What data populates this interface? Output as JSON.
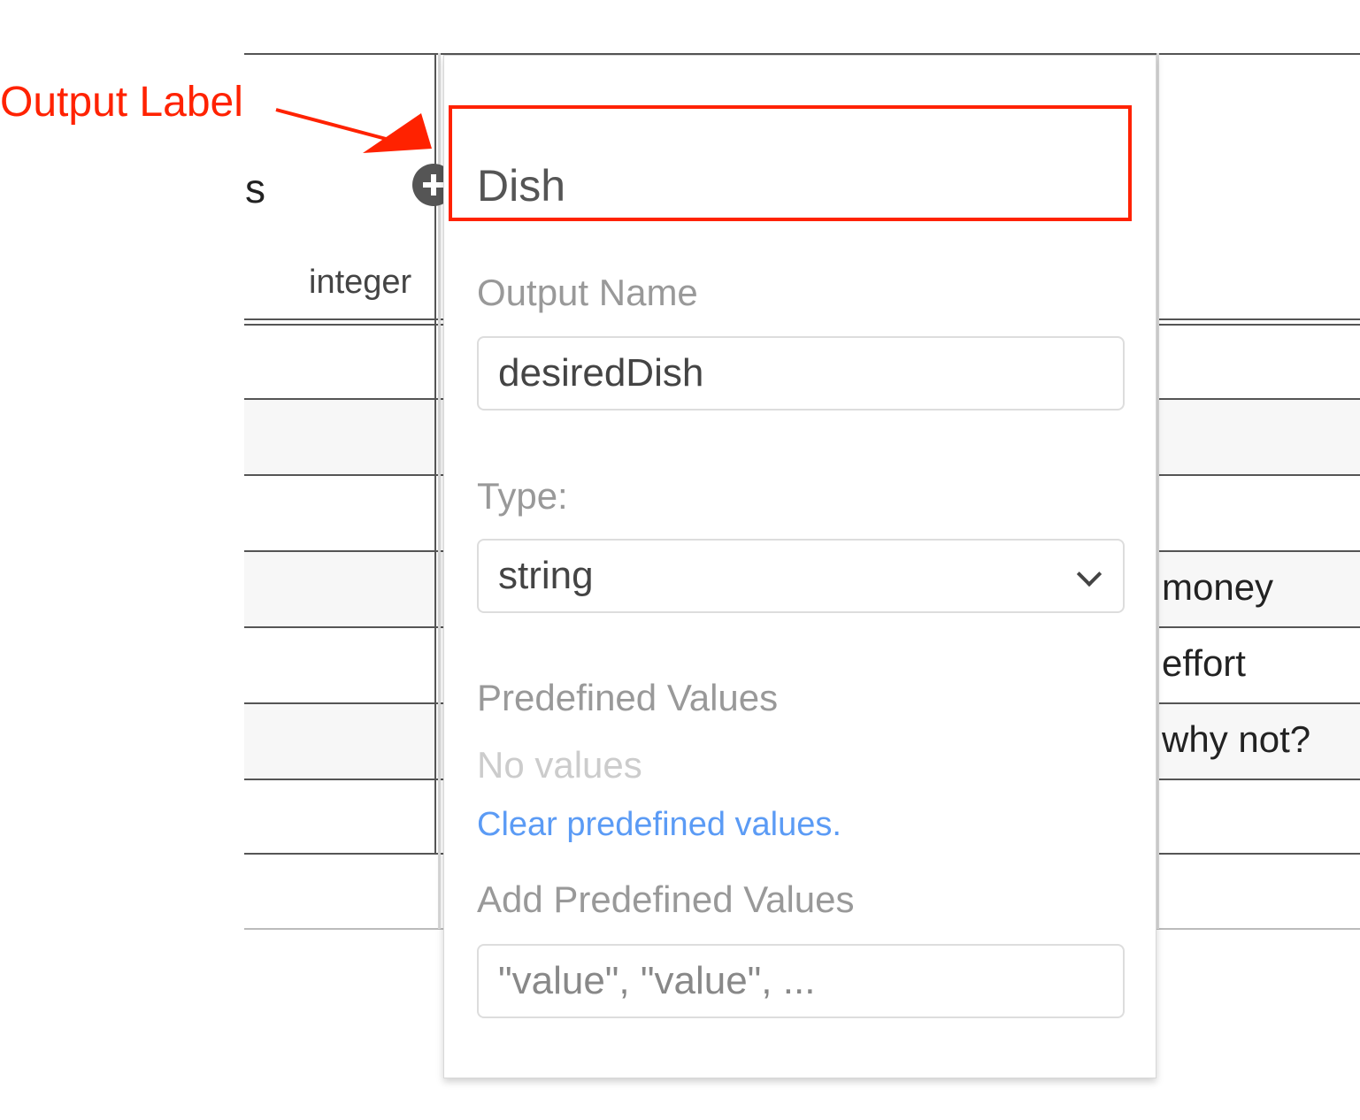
{
  "table": {
    "header_partial": "s",
    "column_type": "integer",
    "right_column_cells": [
      "money",
      "effort",
      "why not?"
    ],
    "add_icon": "plus-circle-icon"
  },
  "popover": {
    "output_label": "Dish",
    "output_name_label": "Output Name",
    "output_name_value": "desiredDish",
    "type_label": "Type:",
    "type_selected": "string",
    "predefined_values_label": "Predefined Values",
    "no_values_text": "No values",
    "clear_link": "Clear predefined values.",
    "add_predefined_label": "Add Predefined Values",
    "add_predefined_placeholder": "\"value\", \"value\", ..."
  },
  "annotation": {
    "label": "Output Label",
    "color": "#ff2200"
  }
}
